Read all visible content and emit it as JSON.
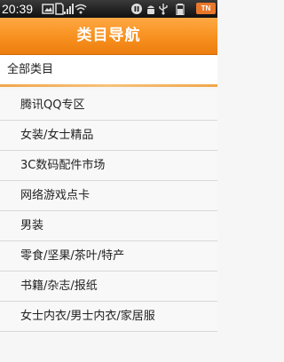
{
  "status_bar": {
    "time": "20:39",
    "badge_text": "TN",
    "icons": [
      "image-icon",
      "sim-icon",
      "signal-icon",
      "wifi-icon",
      "pause-icon",
      "android-icon",
      "usb-icon",
      "battery-icon"
    ]
  },
  "header": {
    "title": "类目导航"
  },
  "all_categories": {
    "label": "全部类目"
  },
  "colors": {
    "accent": "#f7901e",
    "divider": "#f0a64a"
  },
  "categories": [
    {
      "label": "腾讯QQ专区"
    },
    {
      "label": "女装/女士精品"
    },
    {
      "label": "3C数码配件市场"
    },
    {
      "label": "网络游戏点卡"
    },
    {
      "label": "男装"
    },
    {
      "label": "零食/坚果/茶叶/特产"
    },
    {
      "label": "书籍/杂志/报纸"
    },
    {
      "label": "女士内衣/男士内衣/家居服"
    }
  ]
}
